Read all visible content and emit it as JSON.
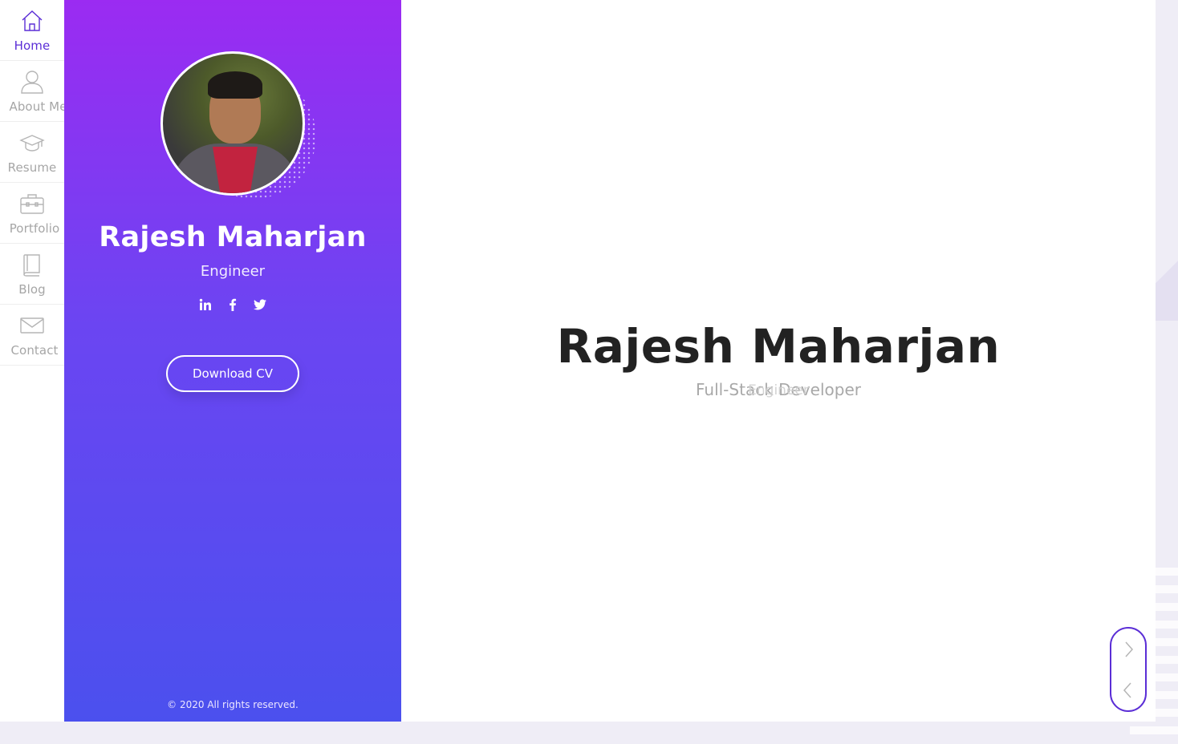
{
  "nav": {
    "items": [
      {
        "label": "Home",
        "icon": "home-icon",
        "active": true
      },
      {
        "label": "About Me",
        "icon": "user-icon",
        "active": false
      },
      {
        "label": "Resume",
        "icon": "graduation-cap-icon",
        "active": false
      },
      {
        "label": "Portfolio",
        "icon": "briefcase-icon",
        "active": false
      },
      {
        "label": "Blog",
        "icon": "book-icon",
        "active": false
      },
      {
        "label": "Contact",
        "icon": "envelope-icon",
        "active": false
      }
    ]
  },
  "profile": {
    "name": "Rajesh Maharjan",
    "role": "Engineer",
    "social": [
      "linkedin-icon",
      "facebook-icon",
      "twitter-icon"
    ],
    "cv_button": "Download CV",
    "copyright": "© 2020 All rights reserved."
  },
  "hero": {
    "name": "Rajesh Maharjan",
    "subtitle": "Full-Stack Developer",
    "subtitle_overlay": "Engineer"
  },
  "colors": {
    "accent": "#5b2ed6",
    "gradient_top": "#9b2bf2",
    "gradient_bottom": "#4b50ee"
  }
}
